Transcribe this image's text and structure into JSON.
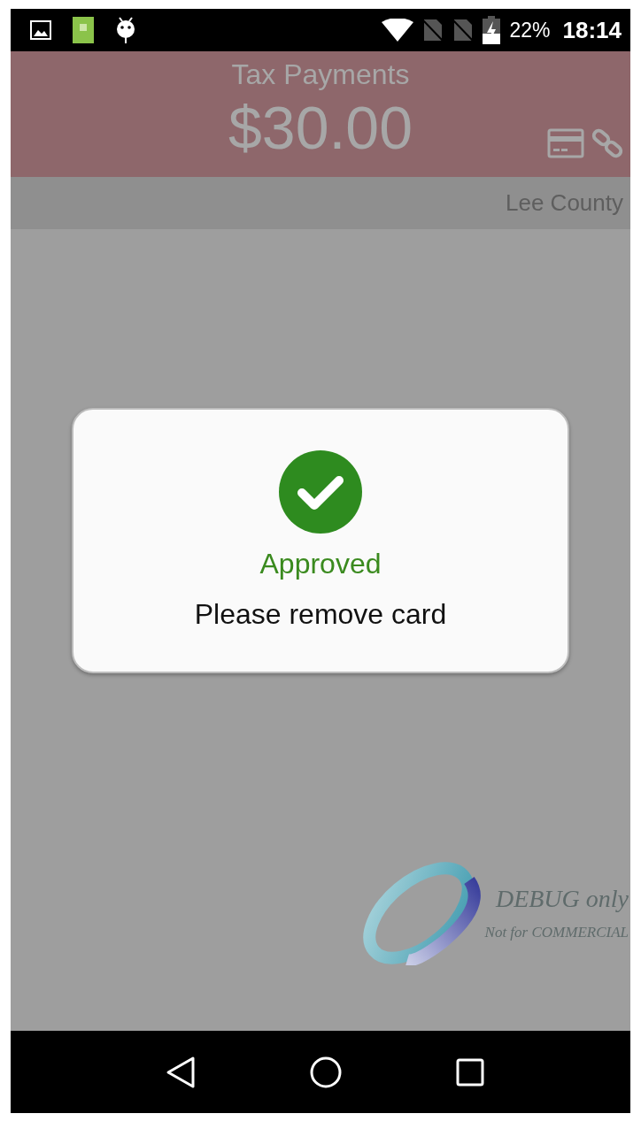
{
  "status_bar": {
    "battery_text": "22%",
    "time": "18:14"
  },
  "header": {
    "title": "Tax Payments",
    "amount": "$30.00"
  },
  "subheader": {
    "location": "Lee County"
  },
  "dialog": {
    "status": "Approved",
    "message": "Please remove card"
  },
  "debug_overlay": {
    "line_1": "DEBUG only",
    "line_2": "Not for COMMERCIAL"
  }
}
